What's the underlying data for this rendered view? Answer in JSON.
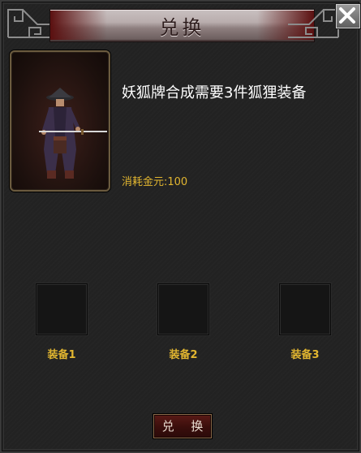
{
  "window": {
    "title": "兑换",
    "close_icon": "close-icon"
  },
  "item": {
    "description": "妖狐牌合成需要3件狐狸装备",
    "cost_text": "消耗金元:100"
  },
  "slots": [
    {
      "label": "装备1"
    },
    {
      "label": "装备2"
    },
    {
      "label": "装备3"
    }
  ],
  "actions": {
    "exchange_label": "兑 换"
  },
  "colors": {
    "accent_gold": "#e2b630",
    "panel_bg": "#222222",
    "title_band": "#b9adad",
    "button_bg": "#3a0e0c"
  }
}
